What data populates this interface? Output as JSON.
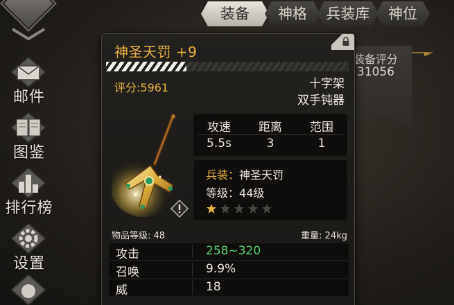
{
  "sidebar": {
    "items": [
      {
        "label": "邮件",
        "icon": "mail-icon"
      },
      {
        "label": "图鉴",
        "icon": "book-icon"
      },
      {
        "label": "排行榜",
        "icon": "ranking-icon"
      },
      {
        "label": "设置",
        "icon": "gear-icon"
      }
    ]
  },
  "tabs": [
    {
      "label": "装备",
      "active": true
    },
    {
      "label": "神格",
      "active": false
    },
    {
      "label": "兵装库",
      "active": false
    },
    {
      "label": "神位",
      "active": false
    }
  ],
  "side_panel": {
    "score_label": "装备评分",
    "score_value": "31056"
  },
  "item": {
    "name": "神圣天罚 +9",
    "durability_fraction": 0.33,
    "score_text": "评分:5961",
    "weapon_type": "十字架",
    "weapon_class": "双手钝器",
    "stats": {
      "headers": [
        "攻速",
        "距离",
        "范围"
      ],
      "values": [
        "5.5s",
        "3",
        "1"
      ]
    },
    "equip": {
      "set_key": "兵装：",
      "set_value": "神圣天罚",
      "level_key": "等级：",
      "level_value": "44级",
      "stars_filled": 1,
      "stars_total": 5
    },
    "item_level_text": "物品等级: 48",
    "weight_text": "重量:  24kg",
    "attributes": [
      {
        "key": "攻击",
        "value": "258~320",
        "highlight": true
      },
      {
        "key": "召唤",
        "value": "9.9%",
        "highlight": false
      },
      {
        "key": "威",
        "value": "18",
        "highlight": false
      }
    ]
  },
  "colors": {
    "accent_gold": "#e7b340",
    "highlight_green": "#58d271"
  }
}
